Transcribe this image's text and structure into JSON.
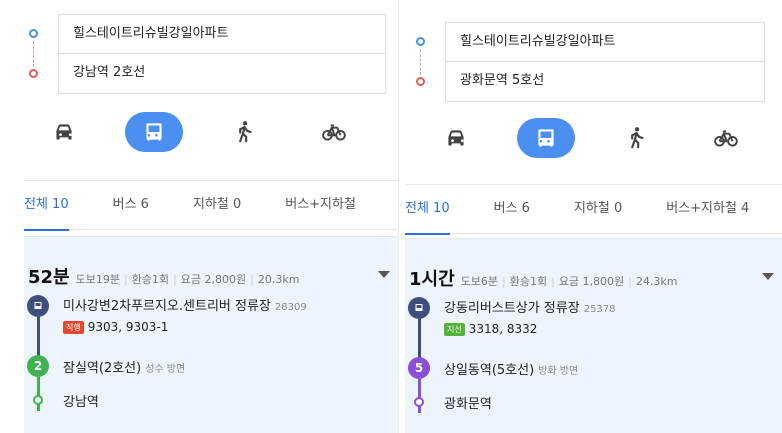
{
  "colors": {
    "accent": "#2e6fd6",
    "mode_active": "#4b8ff0",
    "bus_node": "#3d4f7a",
    "line2_green": "#3fb34f",
    "line5_purple": "#8b4fd8",
    "badge_direct": "#e8472d",
    "badge_branch": "#55b23c",
    "origin_dot": "#4a90e2",
    "dest_dot": "#e25b5b"
  },
  "left": {
    "origin": "힐스테이트리슈빌강일아파트",
    "destination": "강남역 2호선",
    "modes": [
      "car-icon",
      "bus-icon",
      "walk-icon",
      "bike-icon"
    ],
    "active_mode": "bus-icon",
    "tabs": [
      {
        "label": "전체 10"
      },
      {
        "label": "버스 6"
      },
      {
        "label": "지하철 0"
      },
      {
        "label": "버스+지하철"
      }
    ],
    "result": {
      "duration": "52분",
      "walk": "도보19분",
      "transfer": "환승1회",
      "fare": "요금 2,800원",
      "distance": "20.3km",
      "steps": [
        {
          "name": "미사강변2차푸르지오.센트리버 정류장",
          "sub": "28309",
          "badge": "직행",
          "routes": "9303, 9303-1"
        },
        {
          "name": "잠실역(2호선)",
          "sub": "성수 방면",
          "line": "2"
        },
        {
          "name": "강남역"
        }
      ]
    }
  },
  "right": {
    "origin": "힐스테이트리슈빌강일아파트",
    "destination": "광화문역 5호선",
    "modes": [
      "car-icon",
      "bus-icon",
      "walk-icon",
      "bike-icon"
    ],
    "active_mode": "bus-icon",
    "tabs": [
      {
        "label": "전체 10"
      },
      {
        "label": "버스 6"
      },
      {
        "label": "지하철 0"
      },
      {
        "label": "버스+지하철 4"
      }
    ],
    "result": {
      "duration": "1시간",
      "walk": "도보6분",
      "transfer": "환승1회",
      "fare": "요금 1,800원",
      "distance": "24.3km",
      "steps": [
        {
          "name": "강동리버스트상가 정류장",
          "sub": "25378",
          "badge": "지선",
          "routes": "3318, 8332"
        },
        {
          "name": "상일동역(5호선)",
          "sub": "방화 방면",
          "line": "5"
        },
        {
          "name": "광화문역"
        }
      ]
    }
  }
}
